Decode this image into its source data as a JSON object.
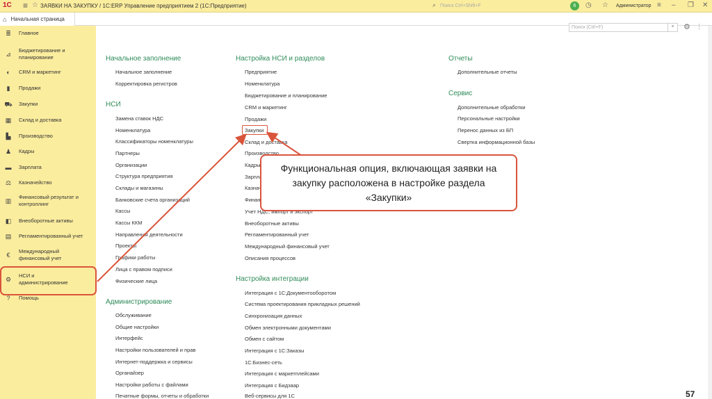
{
  "titlebar": {
    "logo": "1С",
    "title": "ЗАЯВКИ НА ЗАКУПКУ / 1С:ERP Управление предприятием 2  (1С:Предприятие)",
    "search_placeholder": "Поиск Ctrl+Shift+F",
    "notifications": "6",
    "user": "Администратор"
  },
  "tabs": {
    "home": "Начальная страница"
  },
  "sidebar": {
    "items": [
      {
        "label": "Главное",
        "icon": "menu-icon"
      },
      {
        "label": "Бюджетирование и планирование",
        "icon": "chart-icon"
      },
      {
        "label": "CRM и маркетинг",
        "icon": "crm-icon"
      },
      {
        "label": "Продажи",
        "icon": "bag-icon"
      },
      {
        "label": "Закупки",
        "icon": "cart-icon"
      },
      {
        "label": "Склад и доставка",
        "icon": "warehouse-icon"
      },
      {
        "label": "Производство",
        "icon": "factory-icon"
      },
      {
        "label": "Кадры",
        "icon": "person-icon"
      },
      {
        "label": "Зарплата",
        "icon": "money-icon"
      },
      {
        "label": "Казначейство",
        "icon": "treasury-icon"
      },
      {
        "label": "Финансовый результат и контроллинг",
        "icon": "finance-icon"
      },
      {
        "label": "Внеоборотные активы",
        "icon": "assets-icon"
      },
      {
        "label": "Регламентированный учет",
        "icon": "book-icon"
      },
      {
        "label": "Международный финансовый учет",
        "icon": "international-icon"
      },
      {
        "label": "НСИ и администрирование",
        "icon": "gear-icon"
      },
      {
        "label": "Помощь",
        "icon": "help-icon"
      }
    ]
  },
  "main": {
    "search_placeholder": "Поиск (Ctrl+F)",
    "col1": {
      "sections": [
        {
          "heading": "Начальное заполнение",
          "links": [
            "Начальное заполнение",
            "Корректировка регистров"
          ]
        },
        {
          "heading": "НСИ",
          "links": [
            "Замена ставок НДС",
            "Номенклатура",
            "Классификаторы номенклатуры",
            "Партнеры",
            "Организации",
            "Структура предприятия",
            "Склады и магазины",
            "Банковские счета организаций",
            "Кассы",
            "Кассы ККМ",
            "Направления деятельности",
            "Проекты",
            "Графики работы",
            "Лица с правом подписи",
            "Физические лица"
          ]
        },
        {
          "heading": "Администрирование",
          "links": [
            "Обслуживание",
            "Общие настройки",
            "Интерфейс",
            "Настройки пользователей и прав",
            "Интернет-поддержка и сервисы",
            "Органайзер",
            "Настройки работы с файлами",
            "Печатные формы, отчеты и обработки"
          ]
        }
      ]
    },
    "col2": {
      "sections": [
        {
          "heading": "Настройка НСИ и разделов",
          "links": [
            "Предприятие",
            "Номенклатура",
            "Бюджетирование и планирование",
            "CRM и маркетинг",
            "Продажи",
            "Закупки",
            "Склад и доставка",
            "Производство",
            "Кадры",
            "Зарплата",
            "Казначейство и взаиморасчеты",
            "Финансовый результат и контроллинг",
            "Учет НДС, импорт и экспорт",
            "Внеоборотные активы",
            "Регламентированный учет",
            "Международный финансовый учет",
            "Описания процессов"
          ]
        },
        {
          "heading": "Настройка интеграции",
          "links": [
            "Интеграция с 1С:Документооборотом",
            "Система проектирования прикладных решений",
            "Синхронизация данных",
            "Обмен электронными документами",
            "Обмен с сайтом",
            "Интеграция с 1С:Заказы",
            "1С:Бизнес-сеть",
            "Интеграция с маркетплейсами",
            "Интеграция с Бидзаар",
            "Веб-сервисы для 1С"
          ]
        }
      ]
    },
    "col3": {
      "sections": [
        {
          "heading": "Отчеты",
          "links": [
            "Дополнительные отчеты"
          ]
        },
        {
          "heading": "Сервис",
          "links": [
            "Дополнительные обработки",
            "Персональные настройки",
            "Перенос данных из БП",
            "Свертка информационной базы"
          ]
        }
      ]
    }
  },
  "callout": {
    "text": "Функциональная опция, включающая заявки на закупку расположена в настройке раздела «Закупки»"
  },
  "slide_number": "57",
  "colors": {
    "sidebar_bg": "#fbed9e",
    "heading_green": "#2e8b57",
    "highlight_red": "#d9543b"
  }
}
